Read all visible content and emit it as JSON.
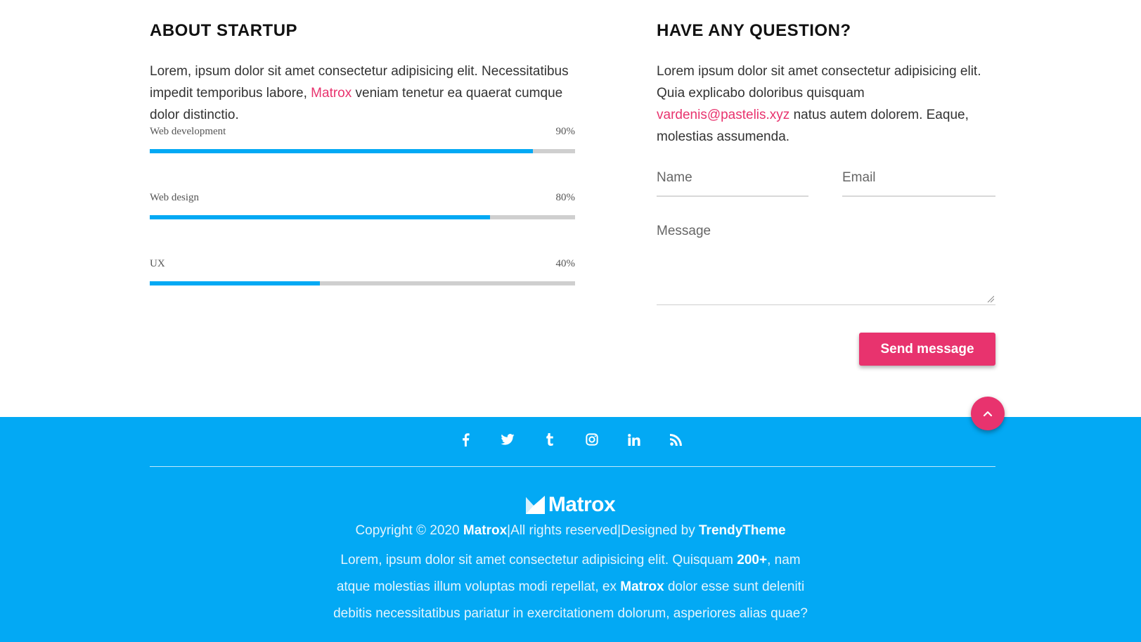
{
  "about": {
    "title": "ABOUT STARTUP",
    "text_before": "Lorem, ipsum dolor sit amet consectetur adipisicing elit. Necessitatibus impedit temporibus labore, ",
    "highlight": "Matrox",
    "text_after": " veniam tenetur ea quaerat cumque dolor distinctio.",
    "skills": [
      {
        "label": "Web development",
        "percent_text": "90%",
        "value": 90
      },
      {
        "label": "Web design",
        "percent_text": "80%",
        "value": 80
      },
      {
        "label": "UX",
        "percent_text": "40%",
        "value": 40
      }
    ]
  },
  "contact": {
    "title": "HAVE ANY QUESTION?",
    "text_before": "Lorem ipsum dolor sit amet consectetur adipisicing elit. Quia explicabo doloribus quisquam ",
    "email": "vardenis@pastelis.xyz",
    "text_after": " natus autem dolorem. Eaque, molestias assumenda.",
    "name_placeholder": "Name",
    "email_placeholder": "Email",
    "message_placeholder": "Message",
    "send_label": "Send message"
  },
  "scroll_top_icon": "chevron-up-icon",
  "footer": {
    "social_icons": [
      "facebook-icon",
      "twitter-icon",
      "tumblr-icon",
      "instagram-icon",
      "linkedin-icon",
      "rss-icon"
    ],
    "logo_text": "Matrox",
    "copyright_prefix": "Copyright © 2020 ",
    "copyright_brand": "Matrox",
    "copyright_mid": "|All rights reserved|Designed by ",
    "copyright_designer": "TrendyTheme",
    "para_1": "Lorem, ipsum dolor sit amet consectetur adipisicing elit. Quisquam ",
    "para_bold_1": "200+",
    "para_2": ", nam atque molestias illum voluptas modi repellat, ex ",
    "para_bold_2": "Matrox",
    "para_3": " dolor esse sunt deleniti debitis necessitatibus pariatur in exercitationem dolorum, asperiores alias quae?"
  },
  "colors": {
    "accent": "#e8336e",
    "primary": "#03a9f4",
    "track": "#cfcfcf"
  }
}
